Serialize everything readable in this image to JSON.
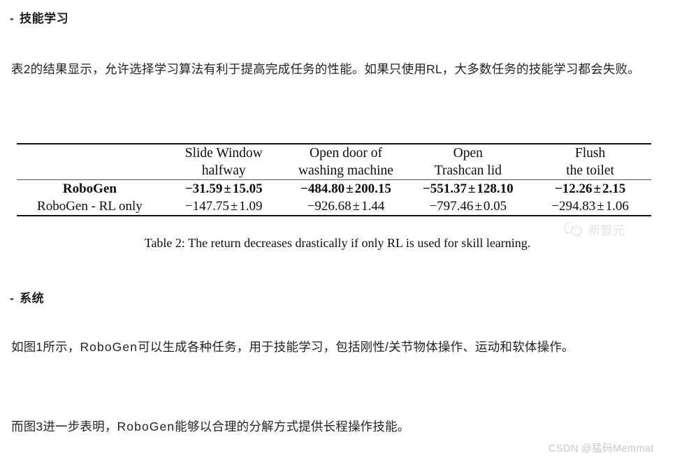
{
  "document": {
    "background_color": "#ffffff",
    "text_color": "#232323"
  },
  "sections": {
    "skill_learning": {
      "dash": "-",
      "heading": "技能学习",
      "paragraph": "表2的结果显示，允许选择学习算法有利于提高完成任务的性能。如果只使用RL，大多数任务的技能学习都会失败。"
    },
    "system": {
      "dash": "-",
      "heading": "系统",
      "paragraph_1_part_a": "如图1所示，",
      "paragraph_1_latin": "RoboGen",
      "paragraph_1_part_b": "可以生成各种任务，用于技能学习，包括刚性/关节物体操作、运动和软体操作。",
      "paragraph_2_part_a": "而图3进一步表明，",
      "paragraph_2_latin": "RoboGen",
      "paragraph_2_part_b": "能够以合理的分解方式提供长程操作技能。"
    }
  },
  "table": {
    "id": "table-2",
    "corner_header": "",
    "columns": [
      {
        "line1": "Slide Window",
        "line2": "halfway"
      },
      {
        "line1": "Open door of",
        "line2": "washing machine"
      },
      {
        "line1": "Open",
        "line2": "Trashcan lid"
      },
      {
        "line1": "Flush",
        "line2": "the toilet"
      }
    ],
    "rows": [
      {
        "label": "RoboGen",
        "bold": true,
        "cells": [
          {
            "mean": "−31.59",
            "pm": "±",
            "std": "15.05"
          },
          {
            "mean": "−484.80",
            "pm": "±",
            "std": "200.15"
          },
          {
            "mean": "−551.37",
            "pm": "±",
            "std": "128.10"
          },
          {
            "mean": "−12.26",
            "pm": "±",
            "std": "2.15"
          }
        ]
      },
      {
        "label": "RoboGen - RL only",
        "bold": false,
        "cells": [
          {
            "mean": "−147.75",
            "pm": "±",
            "std": "1.09"
          },
          {
            "mean": "−926.68",
            "pm": "±",
            "std": "1.44"
          },
          {
            "mean": "−797.46",
            "pm": "±",
            "std": "0.05"
          },
          {
            "mean": "−294.83",
            "pm": "±",
            "std": "1.06"
          }
        ]
      }
    ],
    "caption_label": "Table 2:",
    "caption_text": "The return decreases drastically if only RL is used for skill learning."
  },
  "watermarks": {
    "wechat": {
      "icon": "wechat-icon",
      "text": "新智元",
      "color": "#9a9a9a"
    },
    "csdn": {
      "text": "CSDN @猛码Memmat",
      "color": "#c9c9c9"
    }
  }
}
